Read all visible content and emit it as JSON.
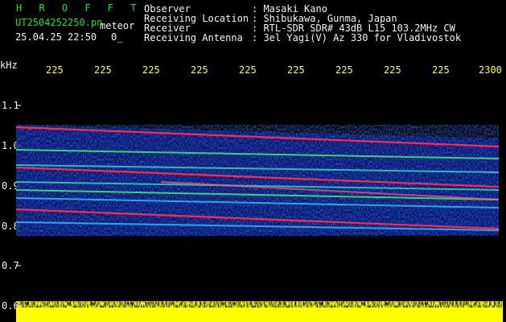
{
  "header": {
    "app_title": "H R O F F T",
    "filename": "UT2504252250.pn",
    "meteor_label": "meteor",
    "datetime": "25.04.25 22:50",
    "count": "0_",
    "info_rows": [
      {
        "label": "Observer",
        "value": ": Masaki Kano"
      },
      {
        "label": "Receiving Location",
        "value": ": Shibukawa, Gunma, Japan"
      },
      {
        "label": "Receiver",
        "value": ": RTL-SDR SDR# 43dB L15 103.2MHz CW"
      },
      {
        "label": "Receiving Antenna",
        "value": ": 3el Yagi(V) Az 330 for Vladivostok"
      }
    ]
  },
  "axes": {
    "y_unit": "kHz",
    "y_ticks": [
      "1.1",
      "1.0",
      "0.9",
      "0.8",
      "0.7",
      "0.6"
    ],
    "time_ticks": [
      "225",
      "225",
      "225",
      "225",
      "225",
      "225",
      "225",
      "225",
      "225",
      "2300"
    ]
  },
  "colors": {
    "background": "#000000",
    "label_green": "#19e619",
    "header_white": "#f2f2f2",
    "tick_yellow": "#ffff22",
    "spectrum_blue": "#0a1ea0",
    "trace_red": "#ff2040",
    "trace_green": "#40ff60",
    "meteor_strip": "#ffff00"
  }
}
